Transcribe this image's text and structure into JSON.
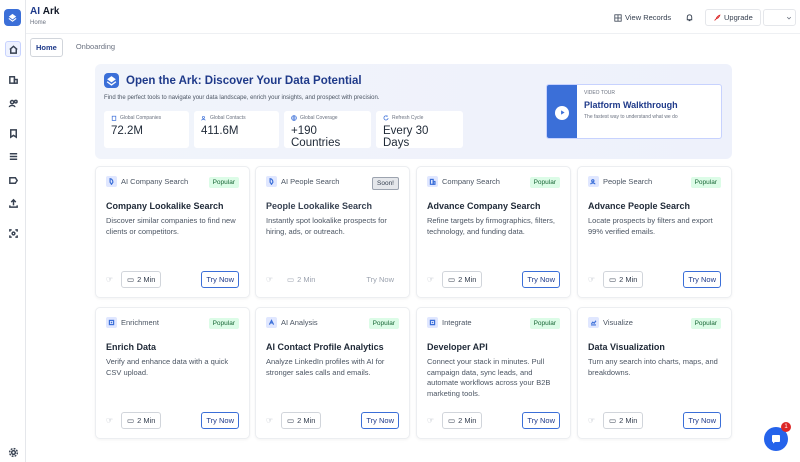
{
  "app": {
    "brand_prefix": "AI",
    "brand_suffix": "Ark",
    "breadcrumb": "Home"
  },
  "topbar": {
    "view_records": "View Records",
    "upgrade": "Upgrade"
  },
  "tabs": [
    {
      "label": "Home",
      "active": true
    },
    {
      "label": "Onboarding",
      "active": false
    }
  ],
  "hero": {
    "title": "Open the Ark: Discover Your Data Potential",
    "subtitle": "Find the perfect tools to navigate your data landscape, enrich your insights, and prospect with precision.",
    "stats": [
      {
        "label": "Global Companies",
        "value": "72.2M"
      },
      {
        "label": "Global Contacts",
        "value": "411.6M"
      },
      {
        "label": "Global Coverage",
        "value": "+190 Countries"
      },
      {
        "label": "Refresh Cycle",
        "value": "Every 30 Days"
      }
    ],
    "video": {
      "tag": "VIDEO TOUR",
      "title": "Platform Walkthrough",
      "desc": "The fastest way to understand what we do"
    }
  },
  "cards": [
    {
      "category": "AI Company Search",
      "badge": "Popular",
      "title": "Company Lookalike Search",
      "desc": "Discover similar companies to find new clients or competitors.",
      "duration": "2 Min",
      "action": "Try Now"
    },
    {
      "category": "AI People Search",
      "badge": "Soon!",
      "title": "People Lookalike Search",
      "desc": "Instantly spot lookalike prospects for hiring, ads, or outreach.",
      "duration": "2 Min",
      "action": "Try Now"
    },
    {
      "category": "Company Search",
      "badge": "Popular",
      "title": "Advance Company Search",
      "desc": "Refine targets by firmographics, filters, technology, and funding data.",
      "duration": "2 Min",
      "action": "Try Now"
    },
    {
      "category": "People Search",
      "badge": "Popular",
      "title": "Advance People Search",
      "desc": "Locate prospects by filters and export 99% verified emails.",
      "duration": "2 Min",
      "action": "Try Now"
    },
    {
      "category": "Enrichment",
      "badge": "Popular",
      "title": "Enrich Data",
      "desc": "Verify and enhance data with a quick CSV upload.",
      "duration": "2 Min",
      "action": "Try Now"
    },
    {
      "category": "AI Analysis",
      "badge": "Popular",
      "title": "AI Contact Profile Analytics",
      "desc": "Analyze LinkedIn profiles with AI for stronger sales calls and emails.",
      "duration": "2 Min",
      "action": "Try Now"
    },
    {
      "category": "Integrate",
      "badge": "Popular",
      "title": "Developer API",
      "desc": "Connect your stack in minutes. Pull campaign data, sync leads, and automate workflows across your B2B marketing tools.",
      "duration": "2 Min",
      "action": "Try Now"
    },
    {
      "category": "Visualize",
      "badge": "Popular",
      "title": "Data Visualization",
      "desc": "Turn any search into charts, maps, and breakdowns.",
      "duration": "2 Min",
      "action": "Try Now"
    }
  ],
  "chat": {
    "badge": "1"
  },
  "colors": {
    "accent": "#3b6fd8",
    "brand": "#1e3a8a",
    "popular_bg": "#dcfce7"
  }
}
